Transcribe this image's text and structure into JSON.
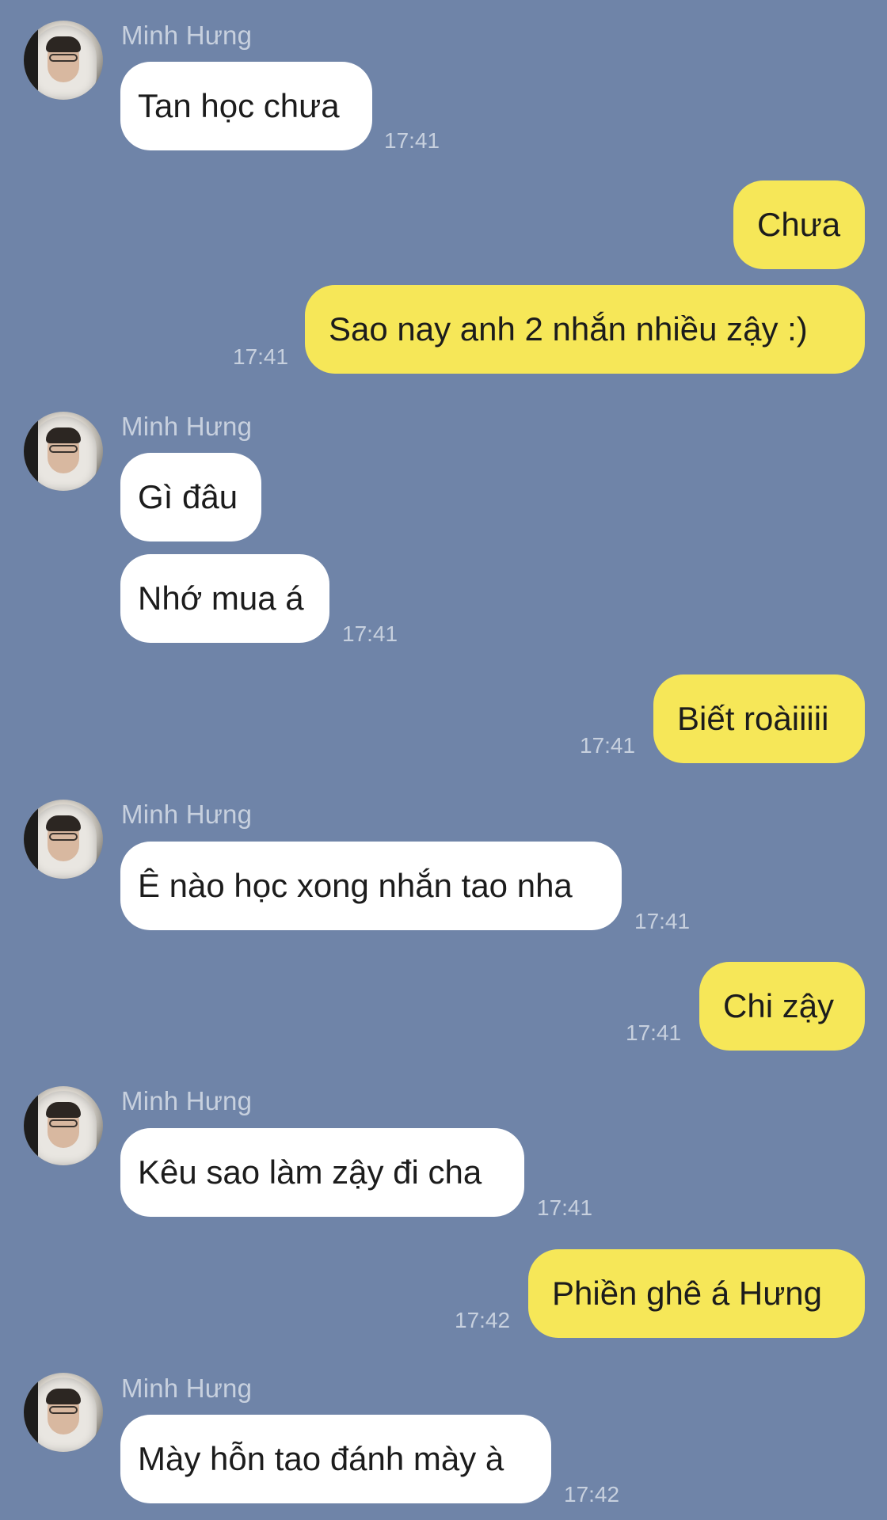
{
  "colors": {
    "background": "#6f84a8",
    "incoming_bubble": "#ffffff",
    "outgoing_bubble": "#f6e758",
    "meta_text": "#c7d0de"
  },
  "contact": {
    "name": "Minh Hưng",
    "avatar_icon": "profile-photo"
  },
  "messages": [
    {
      "dir": "in",
      "sender": "Minh Hưng",
      "text": "Tan học chưa",
      "time": "17:41"
    },
    {
      "dir": "out",
      "text": "Chưa",
      "time": ""
    },
    {
      "dir": "out",
      "text": "Sao nay anh 2 nhắn nhiều zậy :)",
      "time": "17:41"
    },
    {
      "dir": "in",
      "sender": "Minh Hưng",
      "text": "Gì đâu",
      "time": ""
    },
    {
      "dir": "in",
      "text": "Nhớ mua á",
      "time": "17:41"
    },
    {
      "dir": "out",
      "text": "Biết roàiiiii",
      "time": "17:41"
    },
    {
      "dir": "in",
      "sender": "Minh Hưng",
      "text": "Ê nào học xong nhắn tao nha",
      "time": "17:41"
    },
    {
      "dir": "out",
      "text": "Chi zậy",
      "time": "17:41"
    },
    {
      "dir": "in",
      "sender": "Minh Hưng",
      "text": "Kêu sao làm zậy đi cha",
      "time": "17:41"
    },
    {
      "dir": "out",
      "text": "Phiền ghê á Hưng",
      "time": "17:42"
    },
    {
      "dir": "in",
      "sender": "Minh Hưng",
      "text": "Mày hỗn tao đánh mày à",
      "time": "17:42"
    }
  ]
}
